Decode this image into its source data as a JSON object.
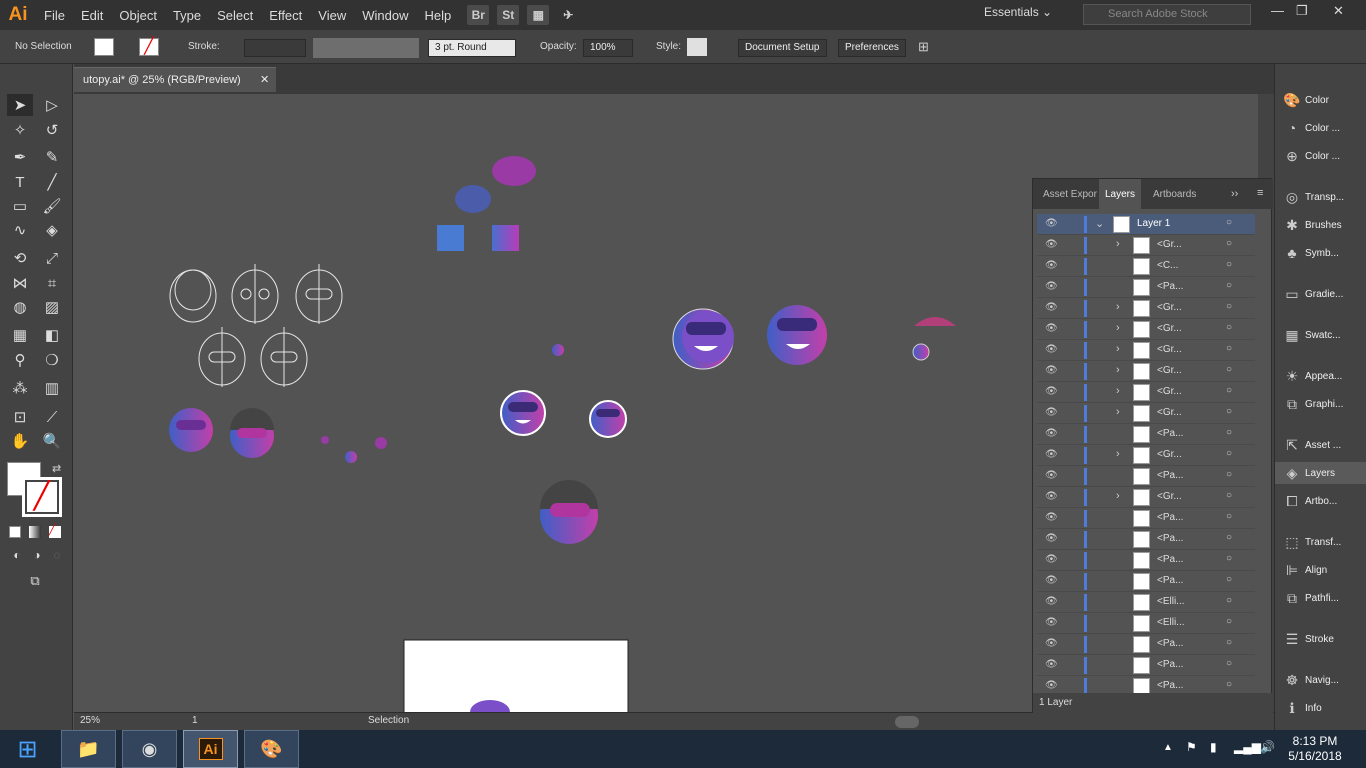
{
  "app": {
    "logo": "Ai"
  },
  "menu": [
    "File",
    "Edit",
    "Object",
    "Type",
    "Select",
    "Effect",
    "View",
    "Window",
    "Help"
  ],
  "menubar_buttons": [
    "Br",
    "St"
  ],
  "workspace": "Essentials",
  "search_placeholder": "Search Adobe Stock",
  "control": {
    "selection": "No Selection",
    "stroke_label": "Stroke:",
    "brush": "3 pt. Round",
    "opacity_label": "Opacity:",
    "opacity_value": "100%",
    "style_label": "Style:",
    "doc_setup": "Document Setup",
    "preferences": "Preferences"
  },
  "document_tab": "utopy.ai* @ 25% (RGB/Preview)",
  "status": {
    "zoom": "25%",
    "page": "1",
    "tool": "Selection"
  },
  "dock": [
    "Color",
    "Color ...",
    "Color ...",
    "Transp...",
    "Brushes",
    "Symb...",
    "Gradie...",
    "Swatc...",
    "Appea...",
    "Graphi...",
    "Asset ...",
    "Layers",
    "Artbo...",
    "Transf...",
    "Align",
    "Pathfi...",
    "Stroke",
    "Navig...",
    "Info"
  ],
  "layers_panel": {
    "tabs": [
      "Asset Expor",
      "Layers",
      "Artboards"
    ],
    "layer_name": "Layer 1",
    "rows": [
      {
        "name": "<Gr...",
        "expand": true
      },
      {
        "name": "<C...",
        "expand": false
      },
      {
        "name": "<Pa...",
        "expand": false
      },
      {
        "name": "<Gr...",
        "expand": true
      },
      {
        "name": "<Gr...",
        "expand": true
      },
      {
        "name": "<Gr...",
        "expand": true
      },
      {
        "name": "<Gr...",
        "expand": true
      },
      {
        "name": "<Gr...",
        "expand": true
      },
      {
        "name": "<Gr...",
        "expand": true
      },
      {
        "name": "<Pa...",
        "expand": false
      },
      {
        "name": "<Gr...",
        "expand": true
      },
      {
        "name": "<Pa...",
        "expand": false
      },
      {
        "name": "<Gr...",
        "expand": true
      },
      {
        "name": "<Pa...",
        "expand": false
      },
      {
        "name": "<Pa...",
        "expand": false
      },
      {
        "name": "<Pa...",
        "expand": false
      },
      {
        "name": "<Pa...",
        "expand": false
      },
      {
        "name": "<Elli...",
        "expand": false
      },
      {
        "name": "<Elli...",
        "expand": false
      },
      {
        "name": "<Pa...",
        "expand": false
      },
      {
        "name": "<Pa...",
        "expand": false
      },
      {
        "name": "<Pa...",
        "expand": false
      }
    ],
    "footer": "1 Layer"
  },
  "clock": {
    "time": "8:13 PM",
    "date": "5/16/2018"
  }
}
